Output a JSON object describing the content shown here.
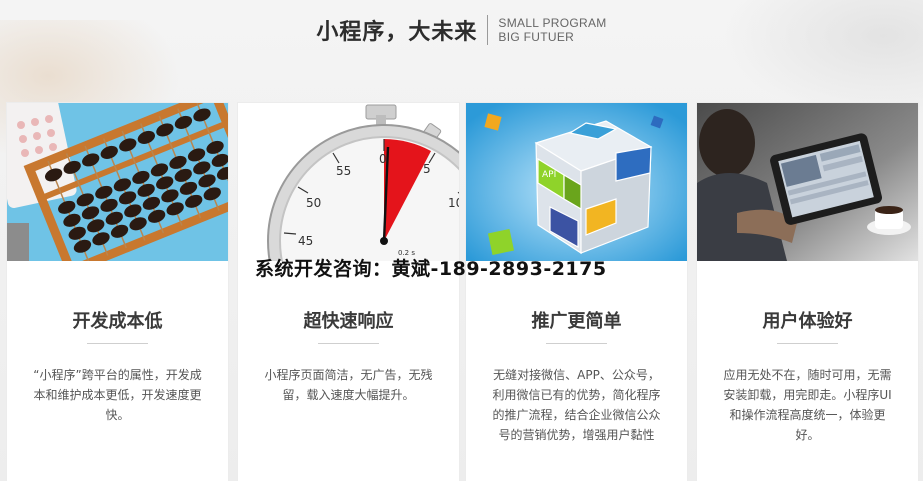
{
  "header": {
    "title": "小程序，大未来",
    "subtitle_line1": "SMALL PROGRAM",
    "subtitle_line2": "BIG FUTUER"
  },
  "overlay_text": "系统开发咨询：黄斌-189-2893-2175",
  "cards": [
    {
      "image_icon": "abacus-image",
      "title": "开发成本低",
      "desc": "“小程序”跨平台的属性，开发成本和维护成本更低，开发速度更快。"
    },
    {
      "image_icon": "stopwatch-image",
      "title": "超快速响应",
      "desc": "小程序页面简洁，无广告，无残留，载入速度大幅提升。",
      "stopwatch_labels": [
        "0",
        "5",
        "55",
        "50",
        "45",
        "10",
        "0.2 s"
      ]
    },
    {
      "image_icon": "cube-image",
      "title": "推广更简单",
      "desc": "无缝对接微信、APP、公众号，利用微信已有的优势，简化程序的推广流程，结合企业微信公众号的营销优势，增强用户黏性",
      "cube_label": "API"
    },
    {
      "image_icon": "tablet-user-image",
      "title": "用户体验好",
      "desc": "应用无处不在，随时可用，无需安装卸载，用完即走。小程序UI和操作流程高度统一，体验更好。"
    }
  ],
  "colors": {
    "background": "#efefef",
    "card": "#ffffff",
    "title": "#3a3a3a",
    "text": "#555555",
    "stopwatch_red": "#e4141b",
    "abacus_bg": "#6fc3e6",
    "cube_bg": "#3aa8e0"
  }
}
